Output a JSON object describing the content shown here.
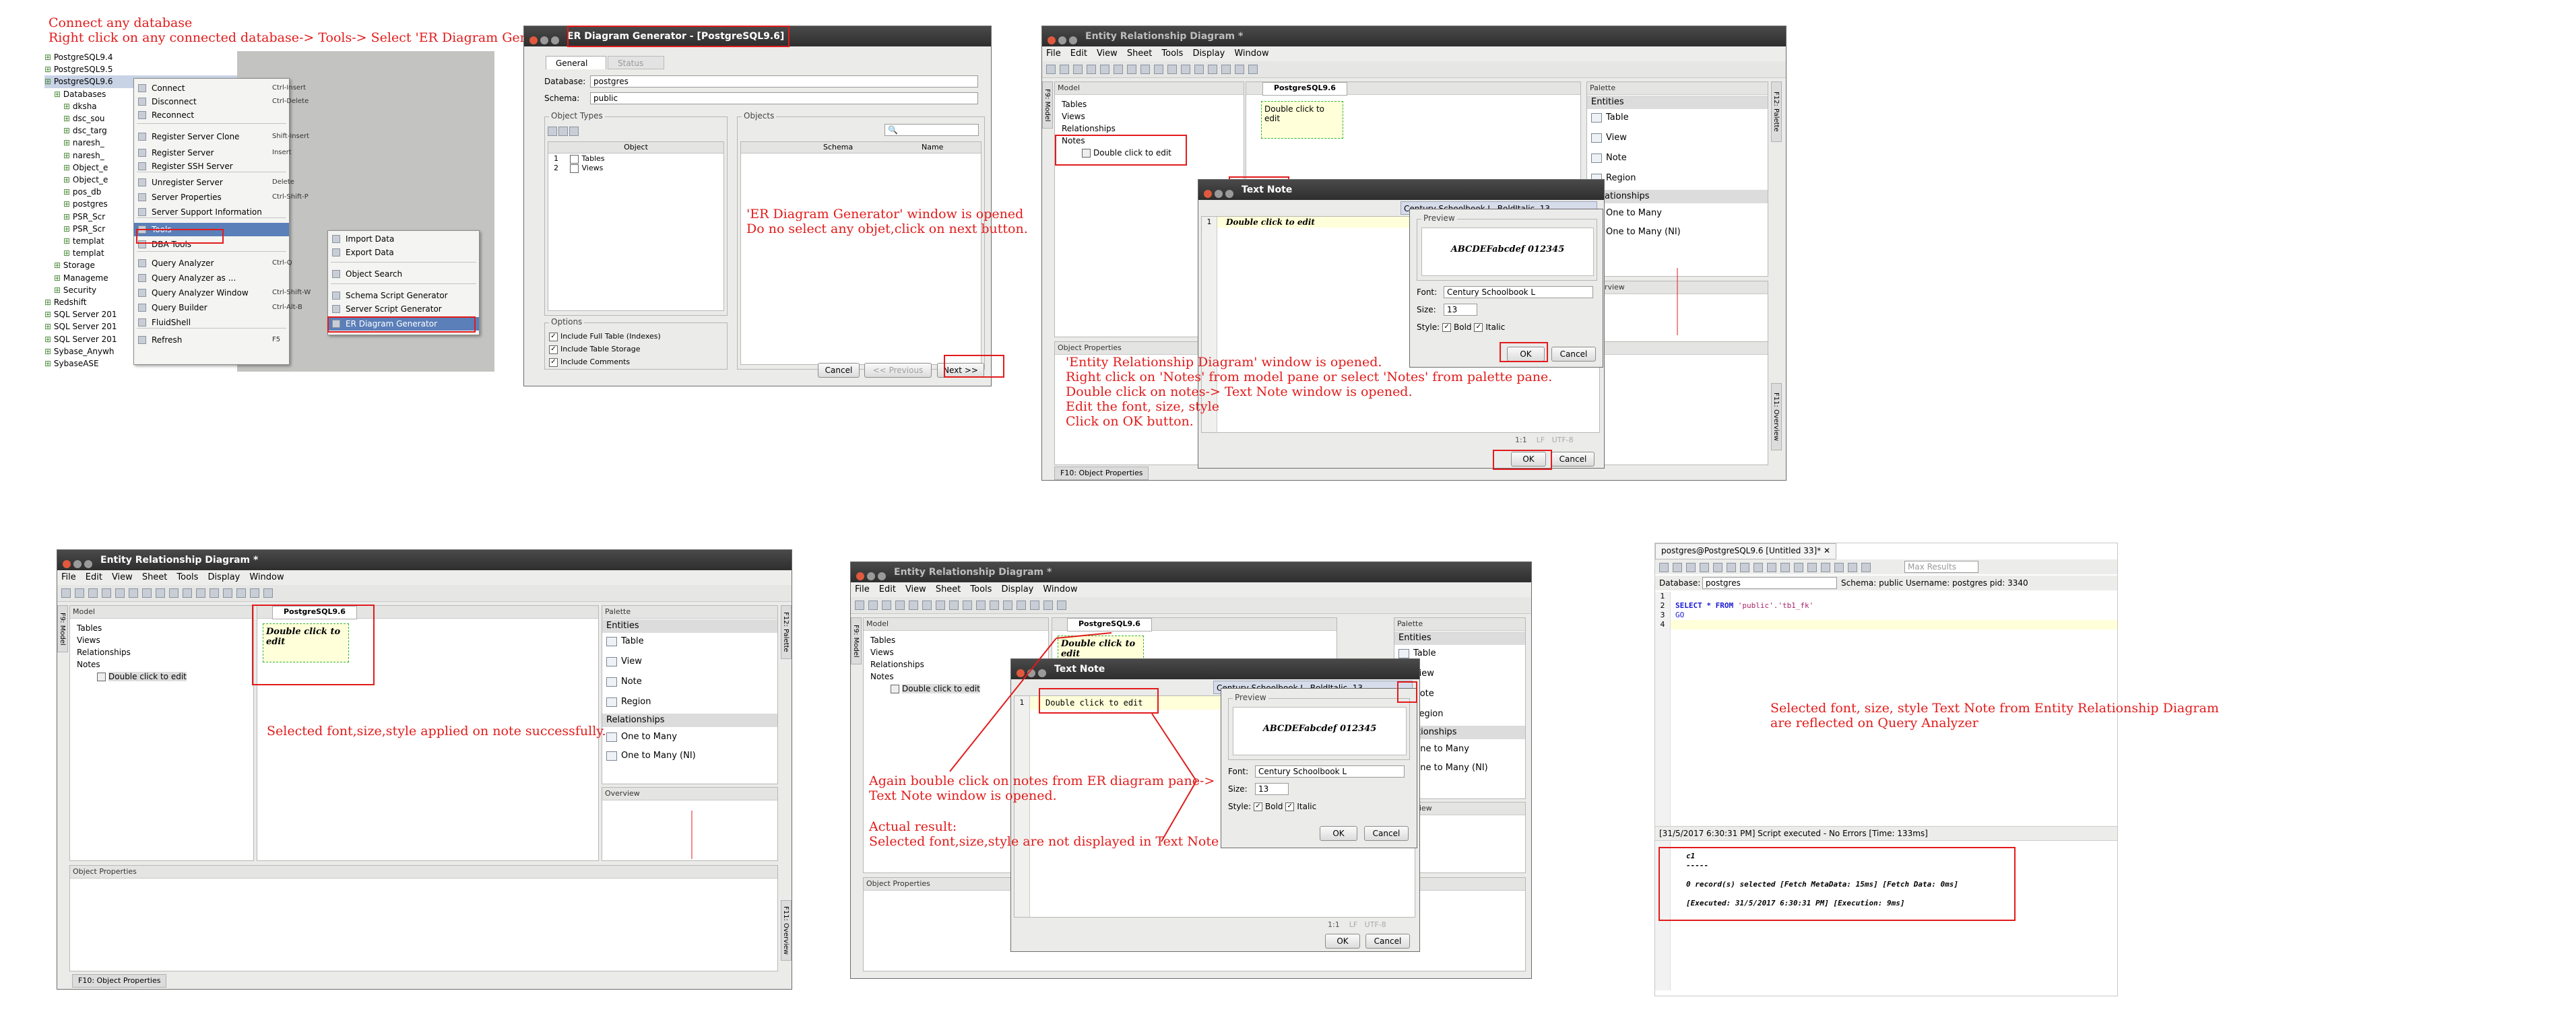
{
  "annotations": {
    "step1_line1": "Connect any database",
    "step1_line2": "Right click on any connected database-> Tools-> Select 'ER Diagram Generator'",
    "step2_line1": "'ER Diagram Generator' window is opened",
    "step2_line2": "Do no select any objet,click on next button.",
    "step3_line1": "'Entity Relationship Diagram' window is opened.",
    "step3_line2": "Right click on 'Notes' from model pane or select 'Notes' from palette pane.",
    "step3_line3": "Double click on notes-> Text Note window is opened.",
    "step3_line4": "Edit the font, size, style",
    "step3_line5": "Click on OK button.",
    "step4": "Selected font,size,style applied on note successfully.",
    "step5_line1": "Again bouble click on notes from ER diagram pane->",
    "step5_line2": " Text Note window is opened.",
    "step5_line3": "Actual result:",
    "step5_line4": "Selected font,size,style are not displayed in Text Note",
    "step6_line1": "Selected font, size, style Text Note from Entity Relationship Diagram",
    "step6_line2": " are reflected on Query Analyzer"
  },
  "tree1": {
    "items": [
      "PostgreSQL9.4",
      "PostgreSQL9.5",
      "PostgreSQL9.6",
      "Databases",
      "dksha",
      "dsc_sou",
      "dsc_targ",
      "naresh_",
      "naresh_",
      "Object_e",
      "Object_e",
      "pos_db",
      "postgres",
      "PSR_Scr",
      "PSR_Scr",
      "templat",
      "templat",
      "Storage",
      "Manageme",
      "Security",
      "Redshift",
      "SQL Server 201",
      "SQL Server 201",
      "SQL Server 201",
      "Sybase_Anywh",
      "SybaseASE"
    ]
  },
  "context_menu": {
    "items": [
      {
        "label": "Connect",
        "shortcut": "Ctrl-Insert"
      },
      {
        "label": "Disconnect",
        "shortcut": "Ctrl-Delete"
      },
      {
        "label": "Reconnect",
        "shortcut": ""
      },
      {
        "label": "Register Server Clone",
        "shortcut": "Shift-Insert"
      },
      {
        "label": "Register Server",
        "shortcut": "Insert"
      },
      {
        "label": "Register SSH Server",
        "shortcut": ""
      },
      {
        "label": "Unregister Server",
        "shortcut": "Delete"
      },
      {
        "label": "Server Properties",
        "shortcut": "Ctrl-Shift-P"
      },
      {
        "label": "Server Support Information",
        "shortcut": ""
      },
      {
        "label": "Tools",
        "shortcut": ""
      },
      {
        "label": "DBA Tools",
        "shortcut": ""
      },
      {
        "label": "Query Analyzer",
        "shortcut": "Ctrl-Q"
      },
      {
        "label": "Query Analyzer as ...",
        "shortcut": ""
      },
      {
        "label": "Query Analyzer Window",
        "shortcut": "Ctrl-Shift-W"
      },
      {
        "label": "Query Builder",
        "shortcut": "Ctrl-Alt-B"
      },
      {
        "label": "FluidShell",
        "shortcut": ""
      },
      {
        "label": "Refresh",
        "shortcut": "F5"
      }
    ]
  },
  "tools_submenu": {
    "items": [
      "Import Data",
      "Export Data",
      "Object Search",
      "Schema Script Generator",
      "Server Script Generator",
      "ER Diagram Generator"
    ]
  },
  "er_generator": {
    "title": "ER Diagram Generator - [PostgreSQL9.6]",
    "tab_general": "General",
    "tab_status": "Status",
    "database_label": "Database:",
    "database_value": "postgres",
    "schema_label": "Schema:",
    "schema_value": "public",
    "object_types_title": "Object Types",
    "object_col": "Object",
    "object_types": [
      {
        "num": "1",
        "name": "Tables"
      },
      {
        "num": "2",
        "name": "Views"
      }
    ],
    "objects_title": "Objects",
    "objects_cols": [
      "Schema",
      "Name"
    ],
    "options_title": "Options",
    "options": [
      "Include Full Table (Indexes)",
      "Include Table Storage",
      "Include Comments"
    ],
    "cancel": "Cancel",
    "previous": "<< Previous",
    "next": "Next >>"
  },
  "erd": {
    "title": "Entity Relationship Diagram *",
    "menu": [
      "File",
      "Edit",
      "View",
      "Sheet",
      "Tools",
      "Display",
      "Window"
    ],
    "model_label": "Model",
    "model_tree": [
      "Tables",
      "Views",
      "Relationships",
      "Notes",
      "Double click to edit"
    ],
    "sheet_tab": "PostgreSQL9.6",
    "note_text": "Double click to edit",
    "palette_label": "Palette",
    "palette_entities": "Entities",
    "palette_items": [
      "Table",
      "View",
      "Note",
      "Region"
    ],
    "palette_relationships": "Relationships",
    "palette_rel_items": [
      "One to Many",
      "One to Many (NI)"
    ],
    "overview_label": "Overview",
    "object_props": "Object Properties",
    "f10_tab": "F10: Object Properties",
    "f12_tab": "F12: Palette",
    "f11_tab": "F11: Overview",
    "f9_tab": "F9: Model"
  },
  "text_note": {
    "title": "Text Note",
    "font_bar": "Century Schoolbook L, BoldItalic, 13",
    "line_no": "1",
    "content": "Double click to edit",
    "preview_label": "Preview",
    "preview_text": "ABCDEFabcdef 012345",
    "font_label": "Font:",
    "font_value": "Century Schoolbook L",
    "size_label": "Size:",
    "size_value": "13",
    "style_label": "Style:",
    "bold": "Bold",
    "italic": "Italic",
    "ok": "OK",
    "cancel": "Cancel",
    "pos": "1:1",
    "lf": "LF",
    "enc": "UTF-8"
  },
  "query": {
    "tab_title": "postgres@PostgreSQL9.6 [Untitled 33]*",
    "max_results": "Max Results",
    "database_label": "Database:",
    "database_value": "postgres",
    "schema_info": "Schema: public   Username: postgres   pid: 3340",
    "line_nums": [
      "1",
      "2",
      "3",
      "4"
    ],
    "sql_keyword": "SELECT * FROM",
    "sql_rest": " 'public'.'tb1_fk'",
    "go": "GO",
    "status": "[31/5/2017 6:30:31 PM] Script executed - No Errors [Time: 133ms]",
    "result_col": "c1",
    "result_sep": "-----",
    "result_line1": "0 record(s) selected [Fetch MetaData: 15ms] [Fetch Data: 0ms]",
    "result_line2": "[Executed: 31/5/2017 6:30:31 PM] [Execution: 9ms]"
  },
  "colors": {
    "annotation": "#e21b1b",
    "selection": "#5b7fb8",
    "titlebar": "#3a3a3a"
  }
}
